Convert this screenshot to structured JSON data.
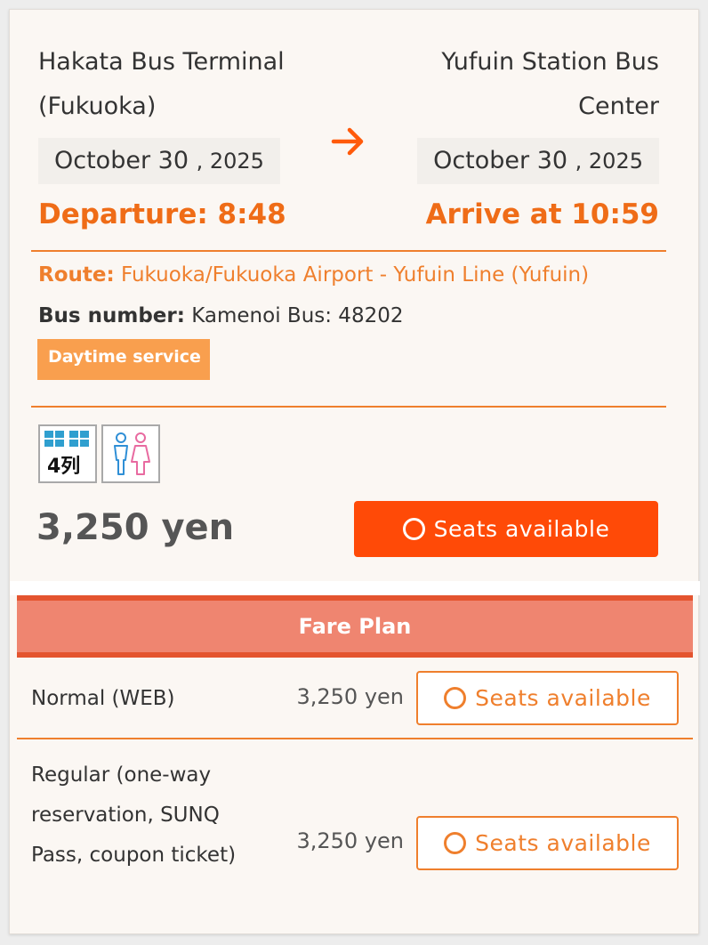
{
  "trip": {
    "departure_place": "Hakata Bus Terminal (Fukuoka)",
    "arrival_place": "Yufuin Station Bus Center",
    "departure_date": "October 30",
    "departure_year": ", 2025",
    "arrival_date": "October 30",
    "arrival_year": ", 2025",
    "departure_time": "Departure: 8:48",
    "arrival_time": "Arrive at 10:59",
    "arrow_icon": "arrow-right-icon"
  },
  "details": {
    "route_label": "Route:",
    "route_value": "Fukuoka/Fukuoka Airport - Yufuin Line (Yufuin)",
    "bus_number_label": "Bus number:",
    "bus_number_value": "Kamenoi Bus: 48202",
    "badge": "Daytime service"
  },
  "amenities": [
    {
      "icon": "four-row-seats-icon",
      "label": "4列"
    },
    {
      "icon": "restroom-icon"
    }
  ],
  "summary": {
    "price": "3,250 yen",
    "availability": "Seats available"
  },
  "fare_plan": {
    "header": "Fare Plan",
    "rows": [
      {
        "name": "Normal (WEB)",
        "price": "3,250 yen",
        "availability": "Seats available"
      },
      {
        "name": "Regular (one-way reservation, SUNQ Pass, coupon ticket)",
        "price": "3,250 yen",
        "availability": "Seats available"
      }
    ]
  },
  "colors": {
    "accent": "#ef6c17",
    "button_fill": "#ff4a07",
    "badge_fill": "#f99f4e",
    "fare_header": "#ef8570"
  }
}
